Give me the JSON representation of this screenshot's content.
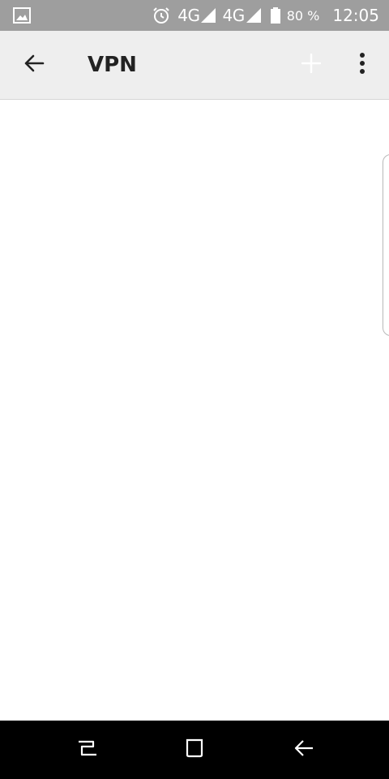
{
  "status_bar": {
    "network_1": "4G",
    "network_2": "4G",
    "battery": "80 %",
    "time": "12:05",
    "icons": [
      "image-icon",
      "alarm-icon",
      "signal-icon",
      "signal-icon",
      "battery-icon"
    ]
  },
  "app_bar": {
    "title": "VPN",
    "icons": [
      "back-arrow-icon",
      "add-icon",
      "more-vert-icon"
    ]
  },
  "nav_bar": {
    "icons": [
      "recents-icon",
      "home-icon",
      "back-icon"
    ]
  },
  "colors": {
    "status_bar_bg": "#9e9e9e",
    "app_bar_bg": "#eeeeee",
    "nav_bar_bg": "#000000",
    "content_bg": "#ffffff",
    "add_icon_disabled": "#e0e0e0"
  }
}
